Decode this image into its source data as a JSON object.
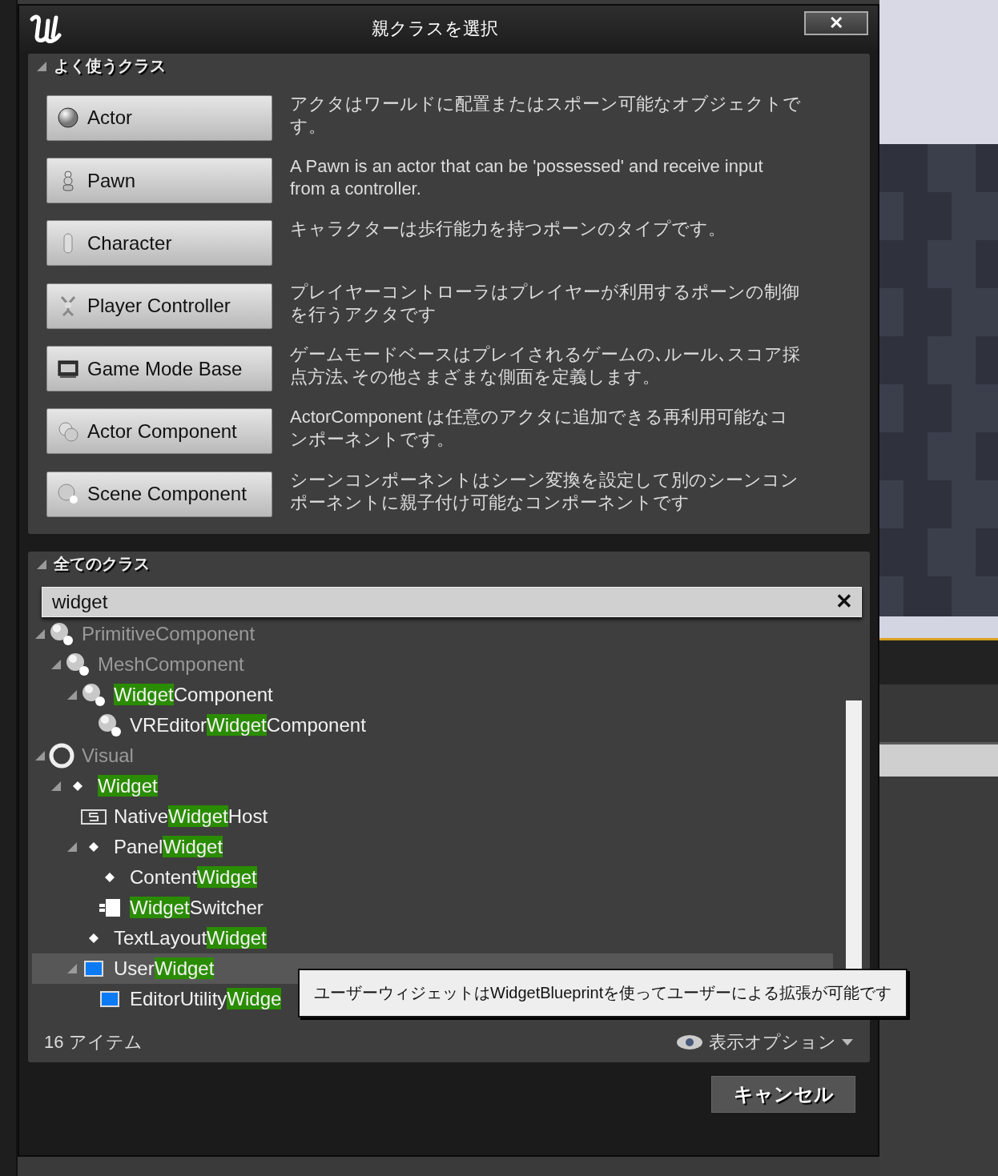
{
  "window": {
    "title": "親クラスを選択",
    "close_label": "✕"
  },
  "common_classes": {
    "title": "よく使うクラス",
    "expanded": true,
    "items": [
      {
        "label": "Actor",
        "kind": "sphere",
        "description": "アクタはワールドに配置またはスポーン可能なオブジェクトです。"
      },
      {
        "label": "Pawn",
        "kind": "pawn",
        "description": "A Pawn is an actor that can be 'possessed' and receive input from a controller."
      },
      {
        "label": "Character",
        "kind": "capsule",
        "description": "キャラクターは歩行能力を持つポーンのタイプです。"
      },
      {
        "label": "Player Controller",
        "kind": "controller",
        "description": "プレイヤーコントローラはプレイヤーが利用するポーンの制御を行うアクタです"
      },
      {
        "label": "Game Mode Base",
        "kind": "gamemode",
        "description": "ゲームモードベースはプレイされるゲームの､ルール､スコア採点方法､その他さまざまな側面を定義します。"
      },
      {
        "label": "Actor Component",
        "kind": "component",
        "description": "ActorComponent は任意のアクタに追加できる再利用可能なコンポーネントです。"
      },
      {
        "label": "Scene Component",
        "kind": "scene",
        "description": "シーンコンポーネントはシーン変換を設定して別のシーンコンポーネントに親子付け可能なコンポーネントです"
      }
    ]
  },
  "all_classes": {
    "title": "全てのクラス",
    "expanded": true,
    "search": {
      "value": "widget",
      "clear_label": "✕"
    },
    "tree": [
      {
        "kind": "sphere",
        "dimmed": true,
        "expanded": true,
        "selected": false,
        "segments": [
          {
            "text": "PrimitiveComponent",
            "match": false
          }
        ],
        "children": [
          {
            "kind": "sphere",
            "dimmed": true,
            "expanded": true,
            "selected": false,
            "segments": [
              {
                "text": "MeshComponent",
                "match": false
              }
            ],
            "children": [
              {
                "kind": "sphere",
                "dimmed": false,
                "expanded": true,
                "selected": false,
                "segments": [
                  {
                    "text": "Widget",
                    "match": true
                  },
                  {
                    "text": "Component",
                    "match": false
                  }
                ],
                "children": [
                  {
                    "kind": "sphere",
                    "dimmed": false,
                    "selected": false,
                    "segments": [
                      {
                        "text": "VREditor",
                        "match": false
                      },
                      {
                        "text": "Widget",
                        "match": true
                      },
                      {
                        "text": "Component",
                        "match": false
                      }
                    ]
                  }
                ]
              }
            ]
          }
        ]
      },
      {
        "kind": "ring",
        "dimmed": true,
        "expanded": true,
        "selected": false,
        "segments": [
          {
            "text": "Visual",
            "match": false
          }
        ],
        "children": [
          {
            "kind": "diamond",
            "dimmed": false,
            "expanded": true,
            "selected": false,
            "segments": [
              {
                "text": "Widget",
                "match": true
              }
            ],
            "children": [
              {
                "kind": "host",
                "dimmed": false,
                "selected": false,
                "segments": [
                  {
                    "text": "Native",
                    "match": false
                  },
                  {
                    "text": "Widget",
                    "match": true
                  },
                  {
                    "text": "Host",
                    "match": false
                  }
                ]
              },
              {
                "kind": "diamond",
                "dimmed": false,
                "expanded": true,
                "selected": false,
                "segments": [
                  {
                    "text": "Panel",
                    "match": false
                  },
                  {
                    "text": "Widget",
                    "match": true
                  }
                ],
                "children": [
                  {
                    "kind": "diamond",
                    "dimmed": false,
                    "selected": false,
                    "segments": [
                      {
                        "text": "Content",
                        "match": false
                      },
                      {
                        "text": "Widget",
                        "match": true
                      }
                    ]
                  },
                  {
                    "kind": "switcher",
                    "dimmed": false,
                    "selected": false,
                    "segments": [
                      {
                        "text": "Widget",
                        "match": true
                      },
                      {
                        "text": "Switcher",
                        "match": false
                      }
                    ]
                  }
                ]
              },
              {
                "kind": "diamond",
                "dimmed": false,
                "selected": false,
                "segments": [
                  {
                    "text": "TextLayout",
                    "match": false
                  },
                  {
                    "text": "Widget",
                    "match": true
                  }
                ]
              },
              {
                "kind": "blue",
                "dimmed": false,
                "expanded": true,
                "selected": true,
                "segments": [
                  {
                    "text": "User",
                    "match": false
                  },
                  {
                    "text": "Widget",
                    "match": true
                  }
                ],
                "children": [
                  {
                    "kind": "blue",
                    "dimmed": false,
                    "selected": false,
                    "segments": [
                      {
                        "text": "EditorUtility",
                        "match": false
                      },
                      {
                        "text": "Widge",
                        "match": true
                      }
                    ]
                  }
                ]
              }
            ]
          }
        ]
      }
    ],
    "item_count": "16 アイテム",
    "view_options": "表示オプション"
  },
  "tooltip": "ユーザーウィジェットはWidgetBlueprintを使ってユーザーによる拡張が可能です",
  "buttons": [
    {
      "label": "キャンセル"
    }
  ]
}
